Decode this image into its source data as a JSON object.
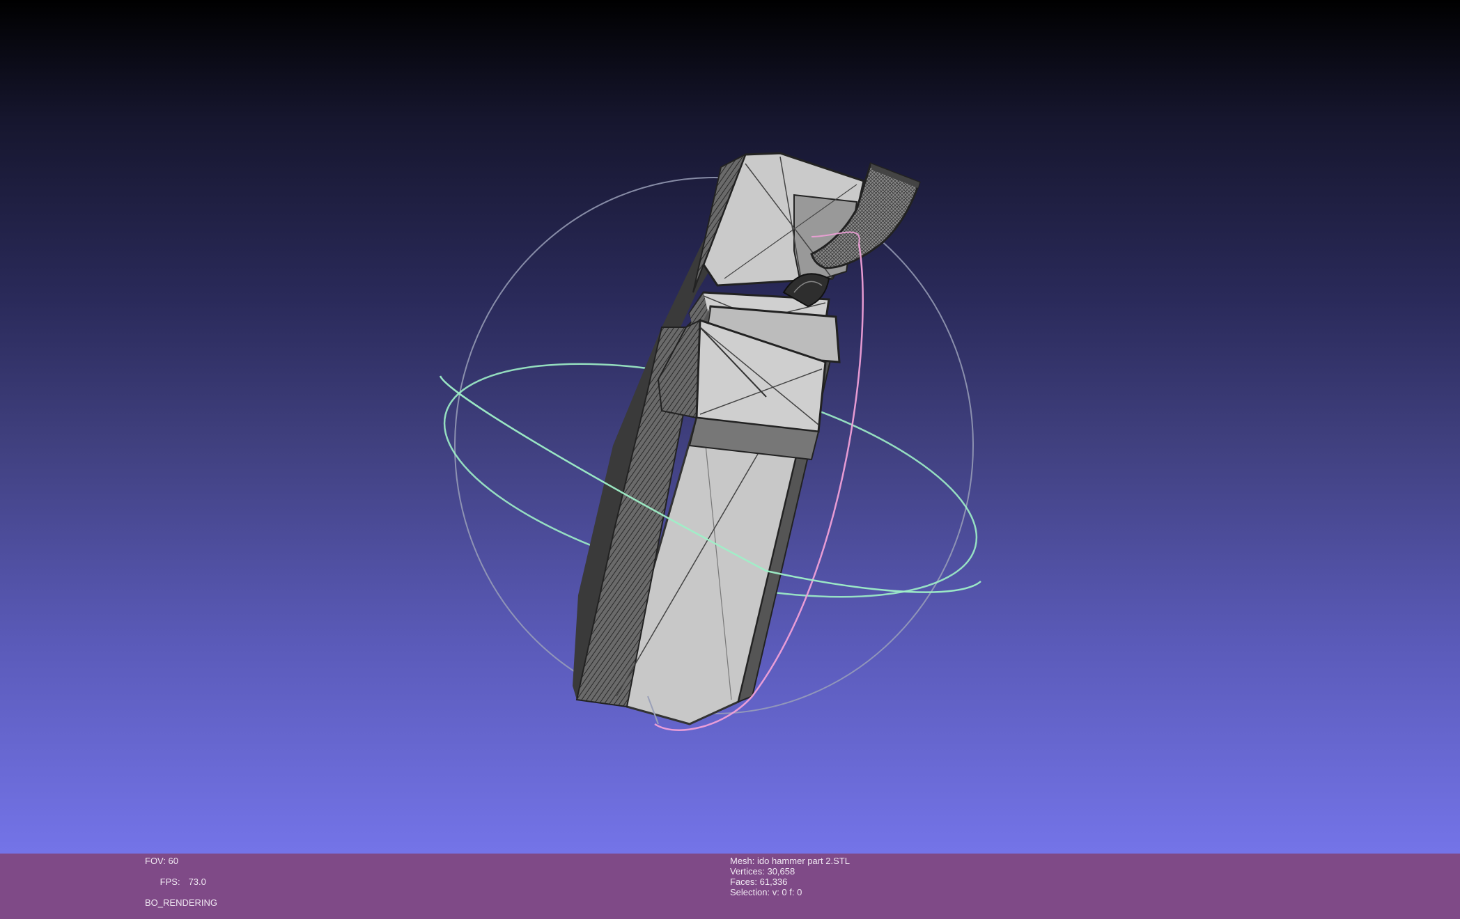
{
  "viewer": {
    "background_top": "#000000",
    "background_bottom": "#7474e8",
    "infobar_color": "#7f4a87",
    "trackball_colors": {
      "horizontal": "#9ff0c8",
      "vertical": "#f0a0d8",
      "outer": "#9aa0b8"
    }
  },
  "info_left": {
    "fov": "FOV: 60",
    "fps_label": "FPS:",
    "fps_value": "73.0",
    "mode": "BO_RENDERING"
  },
  "info_right": {
    "mesh": "Mesh: ido hammer part 2.STL",
    "vertices": "Vertices: 30,658",
    "faces": "Faces: 61,336",
    "selection": "Selection: v: 0 f: 0"
  }
}
